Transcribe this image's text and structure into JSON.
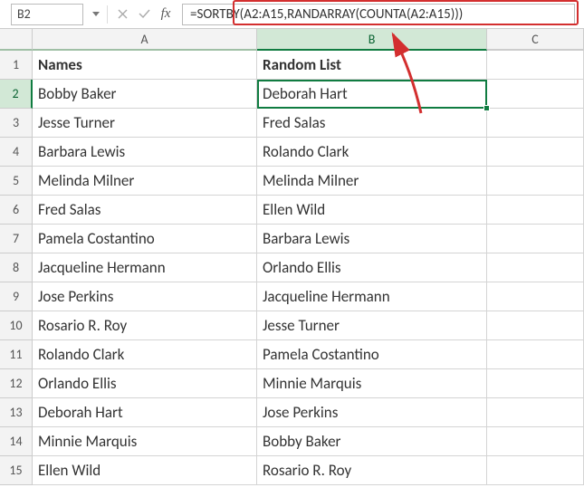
{
  "namebox": "B2",
  "formula": "=SORTBY(A2:A15,RANDARRAY(COUNTA(A2:A15)))",
  "headers": {
    "A": "A",
    "B": "B",
    "C": "C"
  },
  "rows": [
    {
      "n": "1",
      "a": "Names",
      "b": "Random List"
    },
    {
      "n": "2",
      "a": "Bobby Baker",
      "b": "Deborah Hart"
    },
    {
      "n": "3",
      "a": "Jesse Turner",
      "b": "Fred Salas"
    },
    {
      "n": "4",
      "a": "Barbara Lewis",
      "b": "Rolando Clark"
    },
    {
      "n": "5",
      "a": "Melinda Milner",
      "b": "Melinda Milner"
    },
    {
      "n": "6",
      "a": "Fred Salas",
      "b": "Ellen Wild"
    },
    {
      "n": "7",
      "a": "Pamela Costantino",
      "b": "Barbara Lewis"
    },
    {
      "n": "8",
      "a": "Jacqueline Hermann",
      "b": "Orlando Ellis"
    },
    {
      "n": "9",
      "a": "Jose Perkins",
      "b": "Jacqueline Hermann"
    },
    {
      "n": "10",
      "a": "Rosario R. Roy",
      "b": "Jesse Turner"
    },
    {
      "n": "11",
      "a": "Rolando Clark",
      "b": "Pamela Costantino"
    },
    {
      "n": "12",
      "a": "Orlando Ellis",
      "b": "Minnie Marquis"
    },
    {
      "n": "13",
      "a": "Deborah Hart",
      "b": "Jose Perkins"
    },
    {
      "n": "14",
      "a": "Minnie Marquis",
      "b": "Bobby Baker"
    },
    {
      "n": "15",
      "a": "Ellen Wild",
      "b": "Rosario R. Roy"
    }
  ]
}
